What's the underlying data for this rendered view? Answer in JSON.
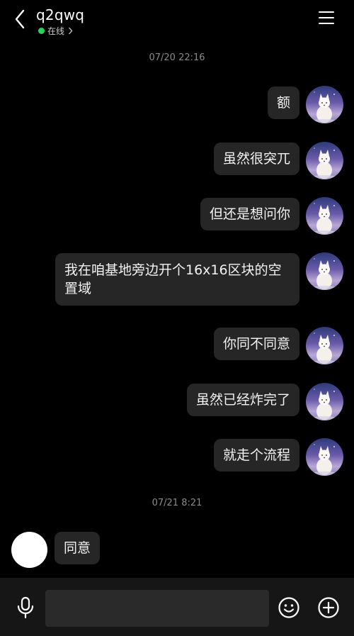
{
  "header": {
    "title": "q2qwq",
    "status": "在线",
    "back_icon": "chevron-left-icon",
    "menu_icon": "hamburger-menu-icon",
    "status_color": "#2bd15f"
  },
  "timestamps": [
    "07/20 22:16",
    "07/21 8:21"
  ],
  "messages": [
    {
      "direction": "out",
      "text": "额"
    },
    {
      "direction": "out",
      "text": "虽然很突兀"
    },
    {
      "direction": "out",
      "text": "但还是想问你"
    },
    {
      "direction": "out",
      "text": "我在咱基地旁边开个16x16区块的空置域"
    },
    {
      "direction": "out",
      "text": "你同不同意"
    },
    {
      "direction": "out",
      "text": "虽然已经炸完了"
    },
    {
      "direction": "out",
      "text": "就走个流程"
    },
    {
      "direction": "in",
      "text": "同意"
    }
  ],
  "input_bar": {
    "value": "",
    "mic_icon": "microphone-icon",
    "emoji_icon": "smiley-icon",
    "plus_icon": "plus-circle-icon"
  },
  "colors": {
    "background": "#000000",
    "bubble": "#262626",
    "input_bar": "#161616"
  }
}
